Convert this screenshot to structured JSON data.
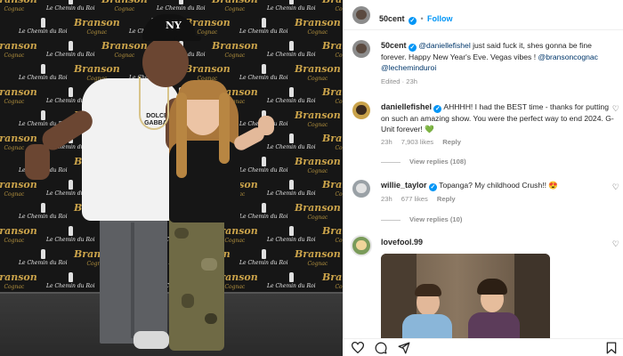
{
  "post": {
    "author": "50cent",
    "follow_label": "Follow",
    "separator": "•",
    "caption_user": "50cent",
    "caption_mention1": "@daniellefishel",
    "caption_text1": " just said fuck it, shes gonna be fine forever. Happy New Year's Eve. Vegas vibes ! ",
    "caption_mention2": "@bransoncognac",
    "caption_mention3": "@lecheminduroi",
    "edited": "Edited · 23h"
  },
  "photo": {
    "backdrop_brand": "Branson",
    "backdrop_brand_sub": "Cognac",
    "backdrop_alt_brand": "Le Chemin du Roi",
    "shirt_text": "DOLCE & GABBANA",
    "cap_logo": "NY"
  },
  "comments": [
    {
      "user": "daniellefishel",
      "verified": true,
      "text": "AHHHH! I had the BEST time - thanks for putting on such an amazing show. You were the perfect way to end 2024. G-Unit forever! 💚",
      "age": "23h",
      "likes": "7,903 likes",
      "reply_label": "Reply",
      "view_replies": "View replies (108)"
    },
    {
      "user": "willie_taylor",
      "verified": true,
      "text": "Topanga? My childhood Crush!! 😍",
      "age": "23h",
      "likes": "677 likes",
      "reply_label": "Reply",
      "view_replies": "View replies (10)"
    },
    {
      "user": "lovefool.99",
      "verified": false
    }
  ],
  "icons": {
    "verified": "verified-check-icon",
    "heart": "heart-outline-icon",
    "comment": "comment-bubble-icon",
    "share": "paper-plane-icon",
    "bookmark": "bookmark-icon"
  },
  "glyphs": {
    "check": "✓",
    "heart": "♡"
  },
  "colors": {
    "accent": "#0095f6",
    "mention": "#00376b",
    "muted": "#8e8e8e",
    "backdrop_gold": "#c9a24a"
  }
}
